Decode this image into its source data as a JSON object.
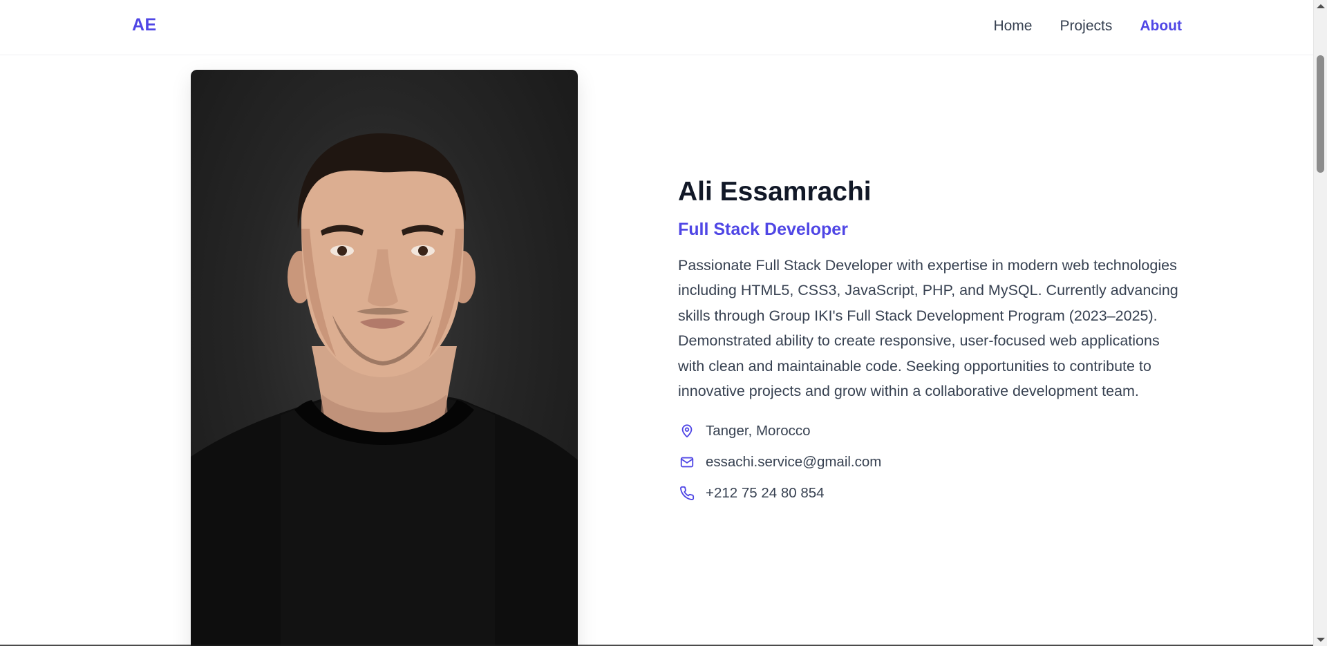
{
  "header": {
    "logo": "AE",
    "nav": [
      {
        "label": "Home",
        "active": false
      },
      {
        "label": "Projects",
        "active": false
      },
      {
        "label": "About",
        "active": true
      }
    ]
  },
  "profile": {
    "photo_icon": "portrait-photo",
    "name": "Ali Essamrachi",
    "title": "Full Stack Developer",
    "bio": "Passionate Full Stack Developer with expertise in modern web technologies including HTML5, CSS3, JavaScript, PHP, and MySQL. Currently advancing skills through Group IKI's Full Stack Development Program (2023–2025). Demonstrated ability to create responsive, user-focused web applications with clean and maintainable code. Seeking opportunities to contribute to innovative projects and grow within a collaborative development team.",
    "contacts": [
      {
        "icon": "map-pin-icon",
        "text": "Tanger, Morocco"
      },
      {
        "icon": "mail-icon",
        "text": "essachi.service@gmail.com"
      },
      {
        "icon": "phone-icon",
        "text": "+212 75 24 80 854"
      }
    ]
  },
  "colors": {
    "accent": "#4f46e5",
    "text": "#374151",
    "heading": "#111827"
  }
}
